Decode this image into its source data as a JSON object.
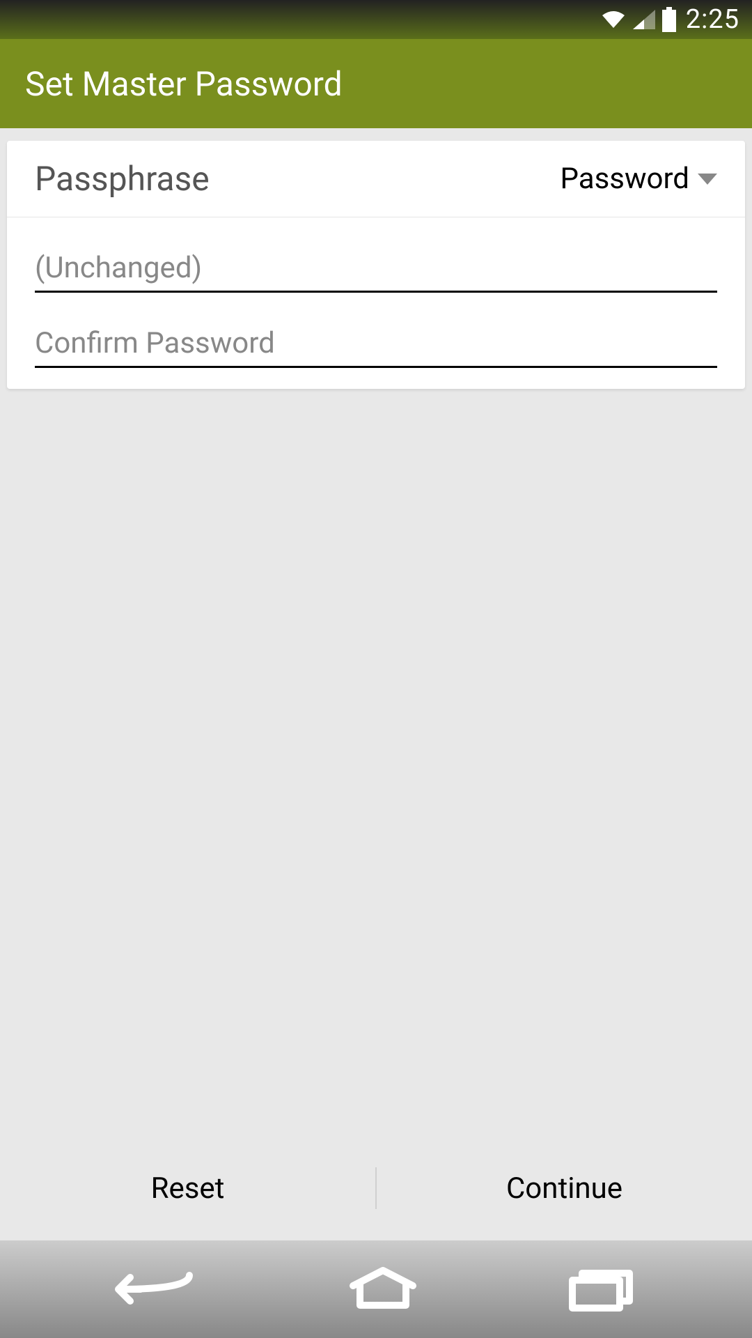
{
  "status": {
    "time": "2:25"
  },
  "appBar": {
    "title": "Set Master Password"
  },
  "card": {
    "title": "Passphrase",
    "dropdown": {
      "selected": "Password"
    },
    "passwordField": {
      "placeholder": "(Unchanged)",
      "value": ""
    },
    "confirmField": {
      "placeholder": "Confirm Password",
      "value": ""
    }
  },
  "actions": {
    "reset": "Reset",
    "continue": "Continue"
  }
}
